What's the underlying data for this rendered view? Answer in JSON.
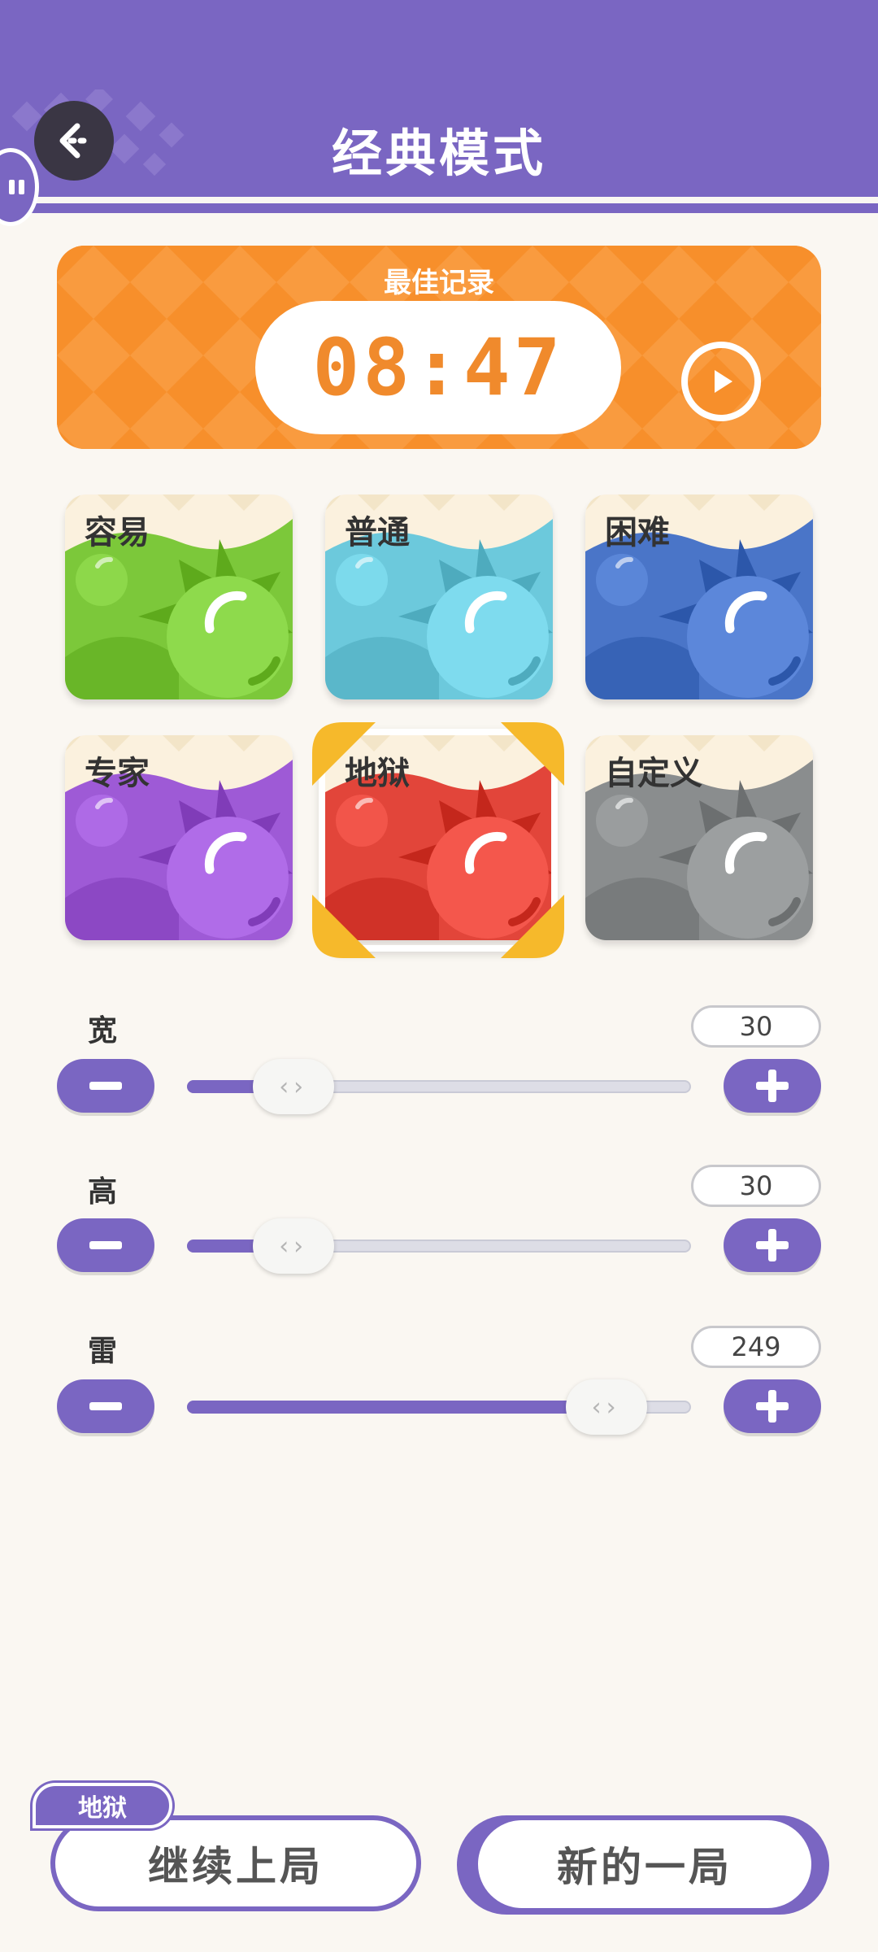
{
  "header": {
    "title": "经典模式",
    "back_icon": "back-arrow-icon",
    "badge_icon": "pause-icon"
  },
  "best_record": {
    "label": "最佳记录",
    "time": "08:47",
    "replay_icon": "play-icon"
  },
  "difficulties": [
    {
      "label": "容易",
      "color": "#7cc83a"
    },
    {
      "label": "普通",
      "color": "#6cc9dc"
    },
    {
      "label": "困难",
      "color": "#4a75c8"
    },
    {
      "label": "专家",
      "color": "#9e5ad6"
    },
    {
      "label": "地狱",
      "color": "#e2453a",
      "selected": true
    },
    {
      "label": "自定义",
      "color": "#8a8d8e"
    }
  ],
  "sliders": {
    "width": {
      "label": "宽",
      "value": "30",
      "fraction": 0.16
    },
    "height": {
      "label": "高",
      "value": "30",
      "fraction": 0.16
    },
    "mines": {
      "label": "雷",
      "value": "249",
      "fraction": 0.78
    }
  },
  "buttons": {
    "continue_tag": "地狱",
    "continue_label": "继续上局",
    "new_game_label": "新的一局"
  },
  "colors": {
    "accent": "#7a66c2",
    "record": "#f78f2b",
    "background": "#faf7f2"
  }
}
